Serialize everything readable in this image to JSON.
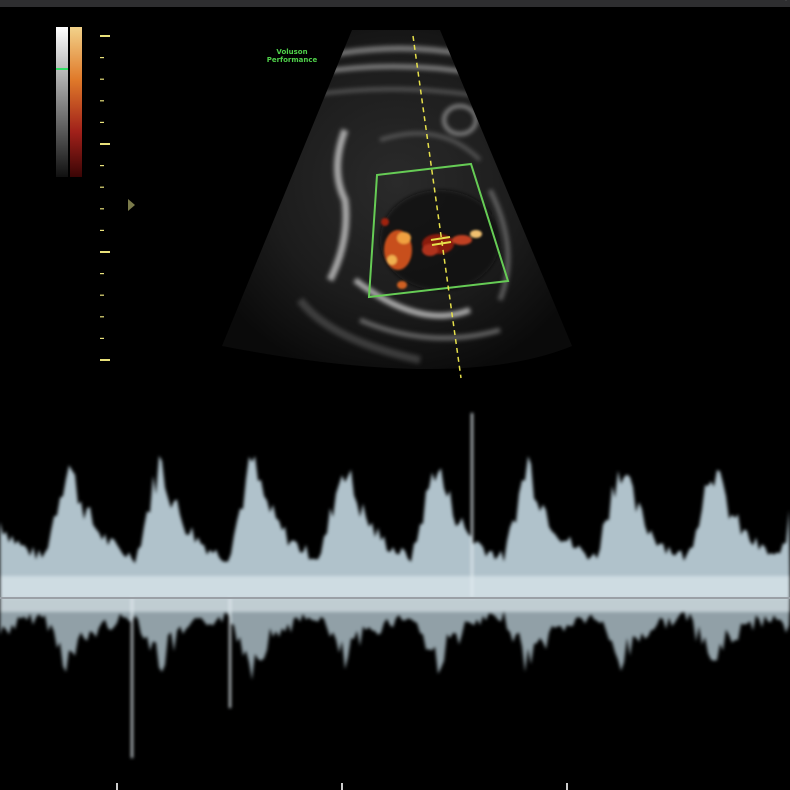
{
  "window": {
    "top_bar_color": "#2e2e30",
    "corner_glyph": "˅"
  },
  "brand": {
    "line1": "Voluson",
    "line2": "Performance",
    "color": "#4fd14a"
  },
  "bmode": {
    "sample_gate_symbol": "=",
    "colorbar_colors": [
      "#f2d28a",
      "#e07a2a",
      "#a0201a",
      "#3a0505"
    ],
    "gray_bar_colors": [
      "#ffffff",
      "#101010"
    ],
    "roi_box_color": "#66cc55",
    "cursor_line_color": "#e6e04a",
    "depth_scale_color": "#e8e07a",
    "focus_marker_color": "#7a7a4a"
  },
  "doppler": {
    "baseline_color": "#9aa0a6",
    "spectrum_color": "#cfe4ee",
    "peak_count": 8
  },
  "time_marks": {
    "color": "#cccccc",
    "count": 3
  }
}
